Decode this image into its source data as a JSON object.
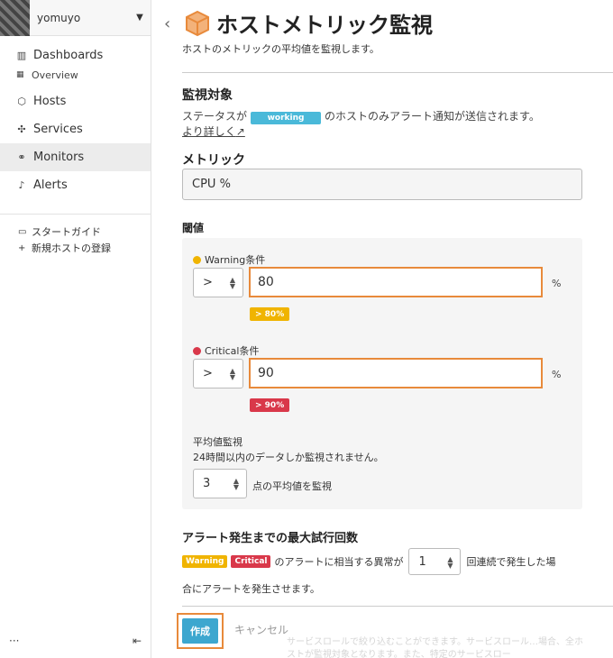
{
  "sidebar": {
    "org_name": "yomuyo",
    "items": [
      {
        "label": "Dashboards",
        "icon": "chart-icon"
      },
      {
        "label": "Hosts",
        "icon": "cube-icon"
      },
      {
        "label": "Services",
        "icon": "cubes-icon"
      },
      {
        "label": "Monitors",
        "icon": "binoculars-icon"
      },
      {
        "label": "Alerts",
        "icon": "bell-icon"
      }
    ],
    "sub_overview": "Overview",
    "links": [
      {
        "label": "スタートガイド",
        "icon": "document-icon"
      },
      {
        "label": "新規ホストの登録",
        "icon": "plus-icon"
      }
    ],
    "bottom_more": "···",
    "bottom_collapse": "⇤"
  },
  "header": {
    "title": "ホストメトリック監視",
    "subtitle": "ホストのメトリックの平均値を監視します。"
  },
  "target": {
    "heading": "監視対象",
    "text_before": "ステータスが",
    "status_badge": "working",
    "text_after": "のホストのみアラート通知が送信されます。",
    "more_link": "より詳しく"
  },
  "metric": {
    "heading": "メトリック",
    "value": "CPU %"
  },
  "threshold": {
    "heading": "閾値",
    "warning_label": "Warning条件",
    "warning_operator": ">",
    "warning_value": "80",
    "warning_unit": "%",
    "warning_pill": "> 80%",
    "critical_label": "Critical条件",
    "critical_operator": ">",
    "critical_value": "90",
    "critical_unit": "%",
    "critical_pill": "> 90%",
    "avg_heading": "平均値監視",
    "avg_note": "24時間以内のデータしか監視されません。",
    "avg_points": "3",
    "avg_suffix": "点の平均値を監視"
  },
  "retry": {
    "heading": "アラート発生までの最大試行回数",
    "warning_tag": "Warning",
    "critical_tag": "Critical",
    "text1": "のアラートに相当する異常が",
    "count": "1",
    "text2": "回連続で発生した場",
    "text3": "合にアラートを発生させます。"
  },
  "actions": {
    "create": "作成",
    "cancel": "キャンセル",
    "faded_text": "サービスロールで絞り込むことができます。サービスロール…場合、全ホストが監視対象となります。また、特定のサービスロー"
  },
  "colors": {
    "accent": "#3da7cf",
    "warning": "#f0b400",
    "critical": "#d9384a",
    "highlight": "#e88a3b",
    "working": "#4ab9d9"
  }
}
